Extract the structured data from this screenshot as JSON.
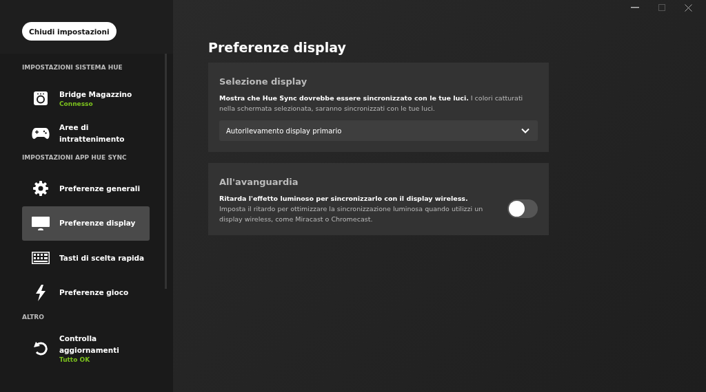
{
  "close_settings_button": "Chiudi impostazioni",
  "sidebar": {
    "sections": [
      {
        "heading": "IMPOSTAZIONI SISTEMA HUE",
        "items": [
          {
            "kind": "bridge",
            "label": "Bridge Magazzino",
            "status": "Connesso",
            "selected": false
          },
          {
            "kind": "gamepad",
            "label": "Aree di intrattenimento",
            "selected": false
          }
        ]
      },
      {
        "heading": "IMPOSTAZIONI APP HUE SYNC",
        "items": [
          {
            "kind": "gear",
            "label": "Preferenze generali",
            "selected": false
          },
          {
            "kind": "monitor",
            "label": "Preferenze display",
            "selected": true
          },
          {
            "kind": "keyboard",
            "label": "Tasti di scelta rapida",
            "selected": false
          },
          {
            "kind": "lightning",
            "label": "Preferenze gioco",
            "selected": false
          }
        ]
      },
      {
        "heading": "ALTRO",
        "items": [
          {
            "kind": "refresh",
            "label": "Controlla aggiornamenti",
            "status": "Tutto OK",
            "selected": false
          }
        ]
      }
    ]
  },
  "page_title": "Preferenze display",
  "cards": [
    {
      "title": "Selezione display",
      "description": "**Mostra che Hue Sync dovrebbe essere sincronizzato con le tue luci.** I colori catturati nella schermata selezionata, saranno sincronizzati con le tue luci.",
      "dropdown": {
        "value": "Autorilevamento display primario"
      }
    },
    {
      "title": "All'avanguardia",
      "description": "**Ritarda l'effetto luminoso per sincronizzarlo con il display wireless.** Imposta il ritardo per ottimizzare la sincronizzazione luminosa quando utilizzi un display wireless, come Miracast o Chromecast.",
      "toggle": {
        "on": false
      }
    }
  ]
}
